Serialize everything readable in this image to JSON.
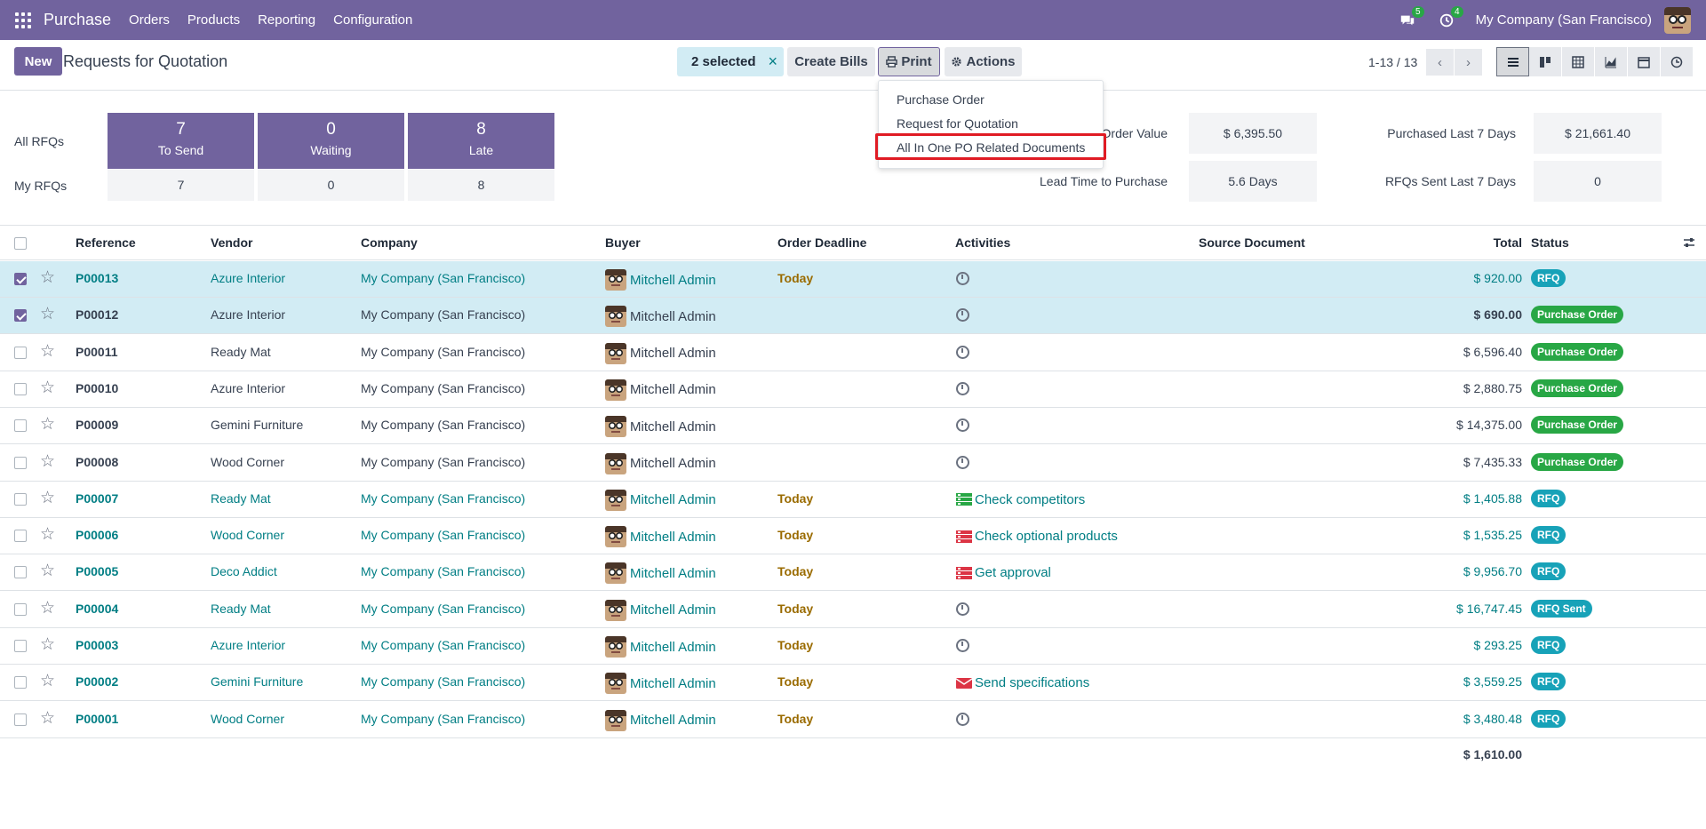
{
  "navbar": {
    "brand": "Purchase",
    "menu": [
      "Orders",
      "Products",
      "Reporting",
      "Configuration"
    ],
    "messages_count": "5",
    "activities_count": "4",
    "company": "My Company (San Francisco)"
  },
  "control_panel": {
    "new_label": "New",
    "title": "Requests for Quotation",
    "selected_label": "2 selected",
    "clear_icon": "×",
    "create_bills_label": "Create Bills",
    "print_label": "Print",
    "actions_label": "Actions",
    "pager": "1-13 / 13"
  },
  "print_menu": {
    "items": [
      "Purchase Order",
      "Request for Quotation",
      "All In One PO Related Documents"
    ],
    "highlighted_item": "All In One PO Related Documents"
  },
  "dashboard": {
    "all_rfqs_label": "All RFQs",
    "my_rfqs_label": "My RFQs",
    "tiles": [
      {
        "count": "7",
        "label": "To Send",
        "my": "7"
      },
      {
        "count": "0",
        "label": "Waiting",
        "my": "0"
      },
      {
        "count": "8",
        "label": "Late",
        "my": "8"
      }
    ],
    "stats": [
      {
        "label": "Order Value",
        "value": "$ 6,395.50"
      },
      {
        "label": "Lead Time to Purchase",
        "value": "5.6 Days"
      },
      {
        "label": "Purchased Last 7 Days",
        "value": "$ 21,661.40"
      },
      {
        "label": "RFQs Sent Last 7 Days",
        "value": "0"
      }
    ],
    "order_value_partial": "Order Value"
  },
  "table": {
    "headers": [
      "Reference",
      "Vendor",
      "Company",
      "Buyer",
      "Order Deadline",
      "Activities",
      "Source Document",
      "Total",
      "Status"
    ],
    "rows": [
      {
        "ref": "P00013",
        "vendor": "Azure Interior",
        "company": "My Company (San Francisco)",
        "buyer": "Mitchell Admin",
        "deadline": "Today",
        "activity": "",
        "total": "$ 920.00",
        "status": "RFQ",
        "selected": true,
        "style": "link"
      },
      {
        "ref": "P00012",
        "vendor": "Azure Interior",
        "company": "My Company (San Francisco)",
        "buyer": "Mitchell Admin",
        "deadline": "",
        "activity": "",
        "total": "$ 690.00",
        "status": "Purchase Order",
        "selected": true,
        "style": "bold"
      },
      {
        "ref": "P00011",
        "vendor": "Ready Mat",
        "company": "My Company (San Francisco)",
        "buyer": "Mitchell Admin",
        "deadline": "",
        "activity": "",
        "total": "$ 6,596.40",
        "status": "Purchase Order",
        "selected": false,
        "style": "plain"
      },
      {
        "ref": "P00010",
        "vendor": "Azure Interior",
        "company": "My Company (San Francisco)",
        "buyer": "Mitchell Admin",
        "deadline": "",
        "activity": "",
        "total": "$ 2,880.75",
        "status": "Purchase Order",
        "selected": false,
        "style": "plain"
      },
      {
        "ref": "P00009",
        "vendor": "Gemini Furniture",
        "company": "My Company (San Francisco)",
        "buyer": "Mitchell Admin",
        "deadline": "",
        "activity": "",
        "total": "$ 14,375.00",
        "status": "Purchase Order",
        "selected": false,
        "style": "plain"
      },
      {
        "ref": "P00008",
        "vendor": "Wood Corner",
        "company": "My Company (San Francisco)",
        "buyer": "Mitchell Admin",
        "deadline": "",
        "activity": "",
        "total": "$ 7,435.33",
        "status": "Purchase Order",
        "selected": false,
        "style": "plain"
      },
      {
        "ref": "P00007",
        "vendor": "Ready Mat",
        "company": "My Company (San Francisco)",
        "buyer": "Mitchell Admin",
        "deadline": "Today",
        "activity": "Check competitors",
        "activity_icon": "todo-green-icon",
        "total": "$ 1,405.88",
        "status": "RFQ",
        "selected": false,
        "style": "link"
      },
      {
        "ref": "P00006",
        "vendor": "Wood Corner",
        "company": "My Company (San Francisco)",
        "buyer": "Mitchell Admin",
        "deadline": "Today",
        "activity": "Check optional products",
        "activity_icon": "todo-red-icon",
        "total": "$ 1,535.25",
        "status": "RFQ",
        "selected": false,
        "style": "link"
      },
      {
        "ref": "P00005",
        "vendor": "Deco Addict",
        "company": "My Company (San Francisco)",
        "buyer": "Mitchell Admin",
        "deadline": "Today",
        "activity": "Get approval",
        "activity_icon": "todo-red-icon",
        "total": "$ 9,956.70",
        "status": "RFQ",
        "selected": false,
        "style": "link"
      },
      {
        "ref": "P00004",
        "vendor": "Ready Mat",
        "company": "My Company (San Francisco)",
        "buyer": "Mitchell Admin",
        "deadline": "Today",
        "activity": "",
        "total": "$ 16,747.45",
        "status": "RFQ Sent",
        "selected": false,
        "style": "link"
      },
      {
        "ref": "P00003",
        "vendor": "Azure Interior",
        "company": "My Company (San Francisco)",
        "buyer": "Mitchell Admin",
        "deadline": "Today",
        "activity": "",
        "total": "$ 293.25",
        "status": "RFQ",
        "selected": false,
        "style": "link"
      },
      {
        "ref": "P00002",
        "vendor": "Gemini Furniture",
        "company": "My Company (San Francisco)",
        "buyer": "Mitchell Admin",
        "deadline": "Today",
        "activity": "Send specifications",
        "activity_icon": "envelope-red-icon",
        "total": "$ 3,559.25",
        "status": "RFQ",
        "selected": false,
        "style": "link"
      },
      {
        "ref": "P00001",
        "vendor": "Wood Corner",
        "company": "My Company (San Francisco)",
        "buyer": "Mitchell Admin",
        "deadline": "Today",
        "activity": "",
        "total": "$ 3,480.48",
        "status": "RFQ",
        "selected": false,
        "style": "link"
      }
    ],
    "footer_total": "$ 1,610.00"
  },
  "colors": {
    "brand": "#71639e",
    "link": "#017e84",
    "rfq_badge": "#17a2b8",
    "po_badge": "#28a745",
    "highlight": "#e01b24"
  }
}
